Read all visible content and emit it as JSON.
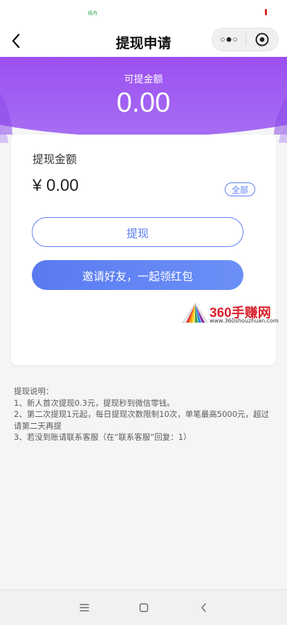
{
  "status_bar": {
    "left_indicator": "纸舟"
  },
  "nav": {
    "title": "提现申请"
  },
  "header": {
    "label": "可提金额",
    "amount": "0.00"
  },
  "card": {
    "title": "提现金额",
    "currency_symbol": "¥",
    "amount": "0.00",
    "all_label": "全部",
    "withdraw_label": "提现",
    "invite_label": "邀请好友，一起领红包"
  },
  "watermark": {
    "title": "360手赚网",
    "url": "www.360shouzhuan.com"
  },
  "notes": {
    "title": "提现说明：",
    "items": [
      "1、新人首次提现0.3元，提现秒到微信零钱。",
      "2、第二次提现1元起，每日提现次数限制10次，单笔最高5000元，超过请第二天再提",
      "3、若没到账请联系客服（在“联系客服”回复：1）"
    ]
  },
  "colors": {
    "accent": "#5b7cf2",
    "header_purple": "#9b55f0"
  },
  "icons": {
    "back": "chevron-left-icon",
    "more": "more-dots-icon",
    "close": "target-circle-icon",
    "menu": "menu-lines-icon",
    "home": "square-home-icon",
    "nav_back": "chevron-left-icon"
  }
}
